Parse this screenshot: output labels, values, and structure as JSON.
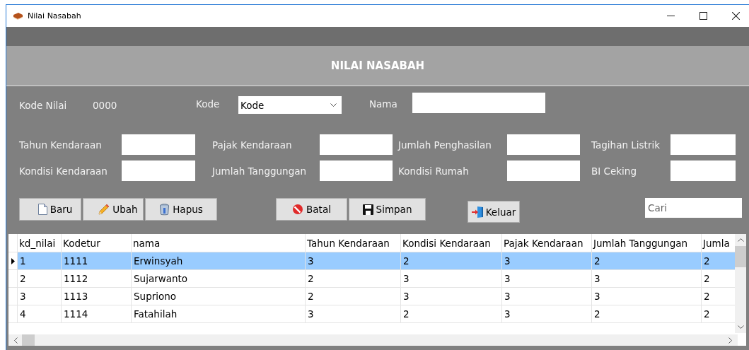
{
  "window": {
    "title": "Nilai Nasabah"
  },
  "header": {
    "title": "NILAI NASABAH"
  },
  "top_row": {
    "kode_nilai_label": "Kode Nilai",
    "kode_nilai_value": "0000",
    "kode_label": "Kode",
    "kode_value": "Kode",
    "nama_label": "Nama"
  },
  "field_rows": [
    {
      "fields": [
        {
          "label": "Tahun Kendaraan"
        },
        {
          "label": "Pajak Kendaraan"
        },
        {
          "label": "Jumlah Penghasilan"
        },
        {
          "label": "Tagihan Listrik"
        }
      ]
    },
    {
      "fields": [
        {
          "label": "Kondisi Kendaraan"
        },
        {
          "label": "Jumlah Tanggungan"
        },
        {
          "label": "Kondisi Rumah"
        },
        {
          "label": "BI Ceking"
        }
      ]
    }
  ],
  "button_groups": [
    {
      "buttons": [
        {
          "label": "Baru",
          "kind": "new"
        },
        {
          "label": "Ubah",
          "kind": "edit"
        },
        {
          "label": "Hapus",
          "kind": "delete"
        }
      ]
    },
    {
      "buttons": [
        {
          "label": "Batal",
          "kind": "cancel"
        },
        {
          "label": "Simpan",
          "kind": "save"
        }
      ]
    },
    {
      "buttons": [
        {
          "label": "Keluar",
          "kind": "exit"
        }
      ]
    }
  ],
  "search": {
    "placeholder": "Cari"
  },
  "table": {
    "columns": [
      "kd_nilai",
      "Kodetur",
      "nama",
      "Tahun Kendaraan",
      "Kondisi Kendaraan",
      "Pajak Kendaraan",
      "Jumlah Tanggungan",
      "Jumla"
    ],
    "rows": [
      {
        "selected": true,
        "cells": [
          "1",
          "1111",
          "Erwinsyah",
          "3",
          "2",
          "3",
          "2",
          "2"
        ]
      },
      {
        "selected": false,
        "cells": [
          "2",
          "1112",
          "Sujarwanto",
          "2",
          "3",
          "3",
          "3",
          "2"
        ]
      },
      {
        "selected": false,
        "cells": [
          "3",
          "1113",
          "Supriono",
          "2",
          "3",
          "3",
          "3",
          "2"
        ]
      },
      {
        "selected": false,
        "cells": [
          "4",
          "1114",
          "Fatahilah",
          "3",
          "2",
          "3",
          "2",
          "2"
        ]
      }
    ]
  }
}
